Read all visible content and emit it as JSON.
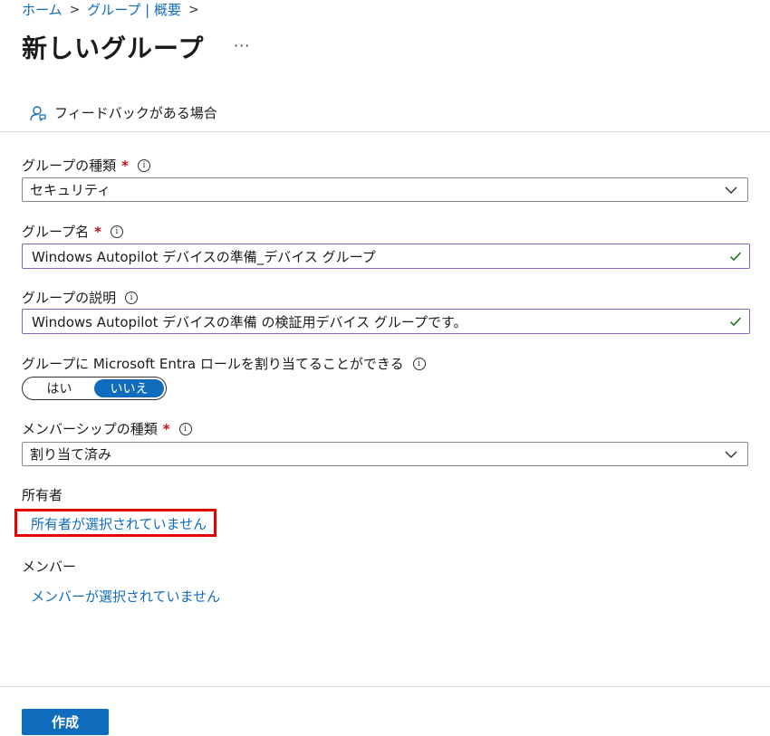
{
  "breadcrumb": {
    "home": "ホーム",
    "group_overview": "グループ | 概要",
    "separator": ">"
  },
  "page": {
    "title": "新しいグループ",
    "more": "···"
  },
  "feedback": {
    "label": "フィードバックがある場合"
  },
  "form": {
    "group_type": {
      "label": "グループの種類",
      "required": "*",
      "value": "セキュリティ"
    },
    "group_name": {
      "label": "グループ名",
      "required": "*",
      "value": "Windows Autopilot デバイスの準備_デバイス グループ"
    },
    "group_description": {
      "label": "グループの説明",
      "value": "Windows Autopilot デバイスの準備 の検証用デバイス グループです。"
    },
    "entra_role": {
      "label": "グループに Microsoft Entra ロールを割り当てることができる",
      "option_yes": "はい",
      "option_no": "いいえ",
      "selected": "いいえ"
    },
    "membership_type": {
      "label": "メンバーシップの種類",
      "required": "*",
      "value": "割り当て済み"
    },
    "owners": {
      "label": "所有者",
      "link": "所有者が選択されていません"
    },
    "members": {
      "label": "メンバー",
      "link": "メンバーが選択されていません"
    }
  },
  "actions": {
    "create": "作成"
  },
  "colors": {
    "accent": "#0f6cbd",
    "required": "#c50f1f",
    "valid": "#107c10",
    "input_border": "#8764b8",
    "highlight": "#e60000"
  }
}
